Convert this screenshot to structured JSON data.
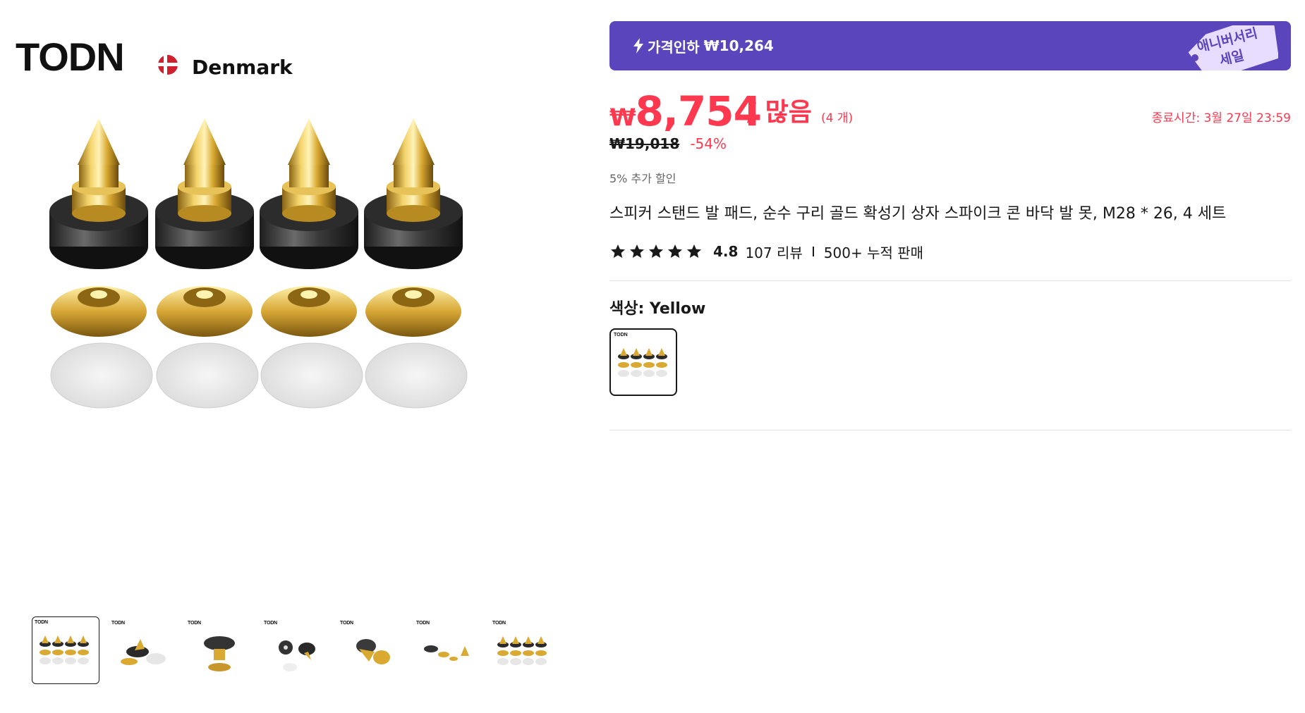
{
  "brand": {
    "logo_text": "TODN",
    "country": "Denmark"
  },
  "gallery": {
    "thumbnail_count": 7,
    "active_index": 0,
    "thumb_logo": "TODN"
  },
  "promo": {
    "label": "가격인하",
    "amount": "₩10,264",
    "tag_text": "애니버서리 세일",
    "background_color": "#5b45bd"
  },
  "pricing": {
    "currency": "₩",
    "price": "8,754",
    "per_unit": "/ 많음",
    "unit_qty": "(4 개)",
    "original_price": "₩19,018",
    "discount": "-54%",
    "end_time": "종료시간: 3월 27일 23:59",
    "extra_discount": "5% 추가 할인",
    "accent_color": "#fd384f"
  },
  "product": {
    "title": "스피커 스탠드 발 패드, 순수 구리 골드 확성기 상자 스파이크 콘 바닥 발 못, M28 * 26, 4 세트"
  },
  "rating": {
    "stars": 5,
    "score": "4.8",
    "reviews": "107 리뷰",
    "sold": "500+ 누적 판매"
  },
  "options": {
    "color_label": "색상: Yellow"
  }
}
